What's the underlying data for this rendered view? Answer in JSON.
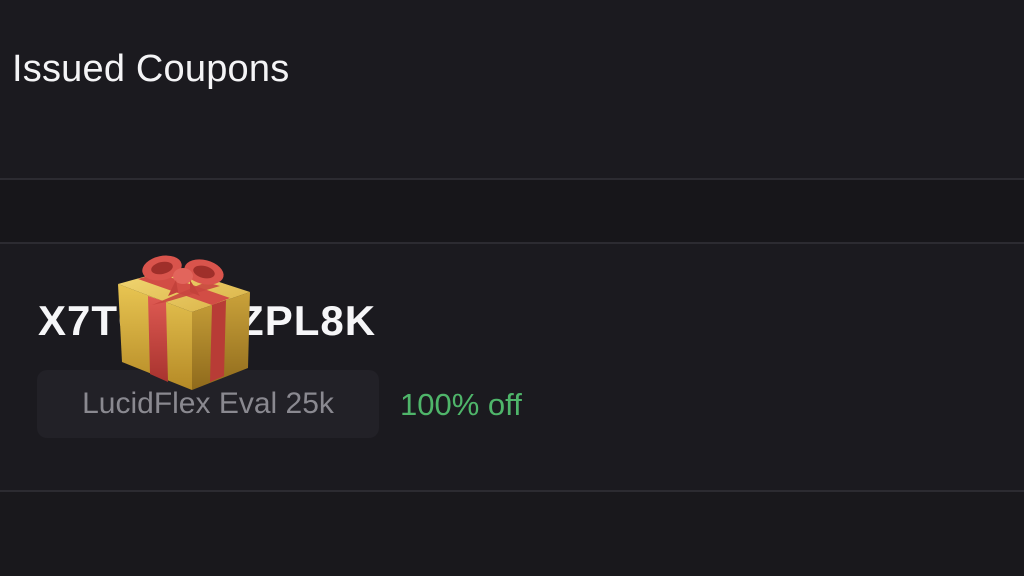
{
  "page": {
    "title": "Issued Coupons"
  },
  "coupon": {
    "code": "X7TC       ZPL8K",
    "product": "LucidFlex Eval 25k",
    "discount": "100% off",
    "overlay_icon": "gift-icon",
    "discount_color": "#4fb56a"
  },
  "colors": {
    "background": "#1a191e",
    "divider": "#2c2b31",
    "chip": "#222127",
    "text": "#f4f4f6",
    "muted": "#8a8990",
    "accent_green": "#4fb56a"
  }
}
